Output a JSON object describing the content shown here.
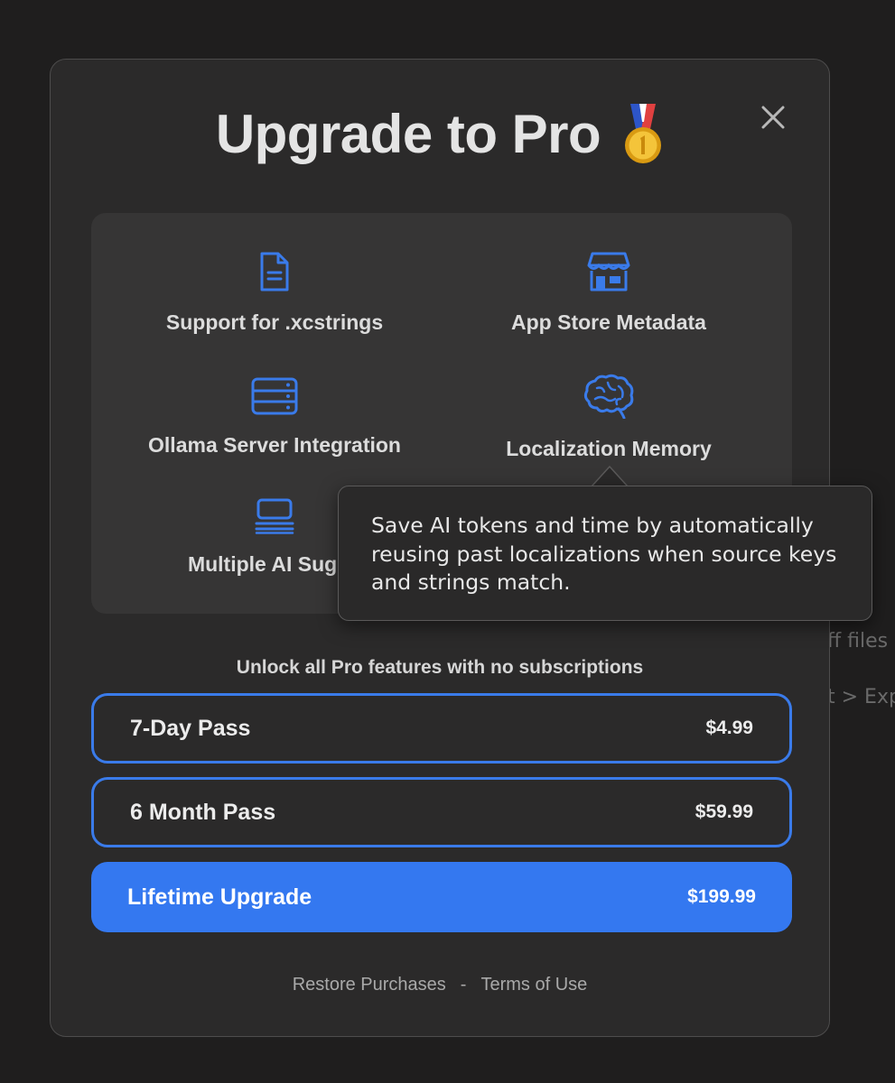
{
  "background": {
    "snippet_1": "ff files",
    "snippet_2": "t > Exp"
  },
  "modal": {
    "title": "Upgrade to Pro",
    "title_emoji": "1st-place-medal",
    "close_icon": "close-icon"
  },
  "features": [
    {
      "label": "Support for .xcstrings",
      "icon": "document-icon"
    },
    {
      "label": "App Store Metadata",
      "icon": "storefront-icon"
    },
    {
      "label": "Ollama Server Integration",
      "icon": "server-rack-icon"
    },
    {
      "label": "Localization Memory",
      "icon": "brain-icon"
    },
    {
      "label": "Multiple AI Sugge",
      "icon": "list-monitor-icon"
    }
  ],
  "tooltip": {
    "line_1": "Save AI tokens and time by automatically",
    "line_2": "reusing past localizations when source keys",
    "line_3": "and strings match."
  },
  "unlock_text": "Unlock all Pro features with no subscriptions",
  "plans": [
    {
      "name": "7-Day Pass",
      "price": "$4.99",
      "style": "outline"
    },
    {
      "name": "6 Month Pass",
      "price": "$59.99",
      "style": "outline"
    },
    {
      "name": "Lifetime Upgrade",
      "price": "$199.99",
      "style": "filled"
    }
  ],
  "footer": {
    "restore": "Restore Purchases",
    "separator": "-",
    "terms": "Terms of Use"
  },
  "colors": {
    "accent": "#3478f0",
    "icon_blue": "#3a7bea",
    "modal_bg": "#2b2a2a",
    "panel_bg": "#363535"
  }
}
